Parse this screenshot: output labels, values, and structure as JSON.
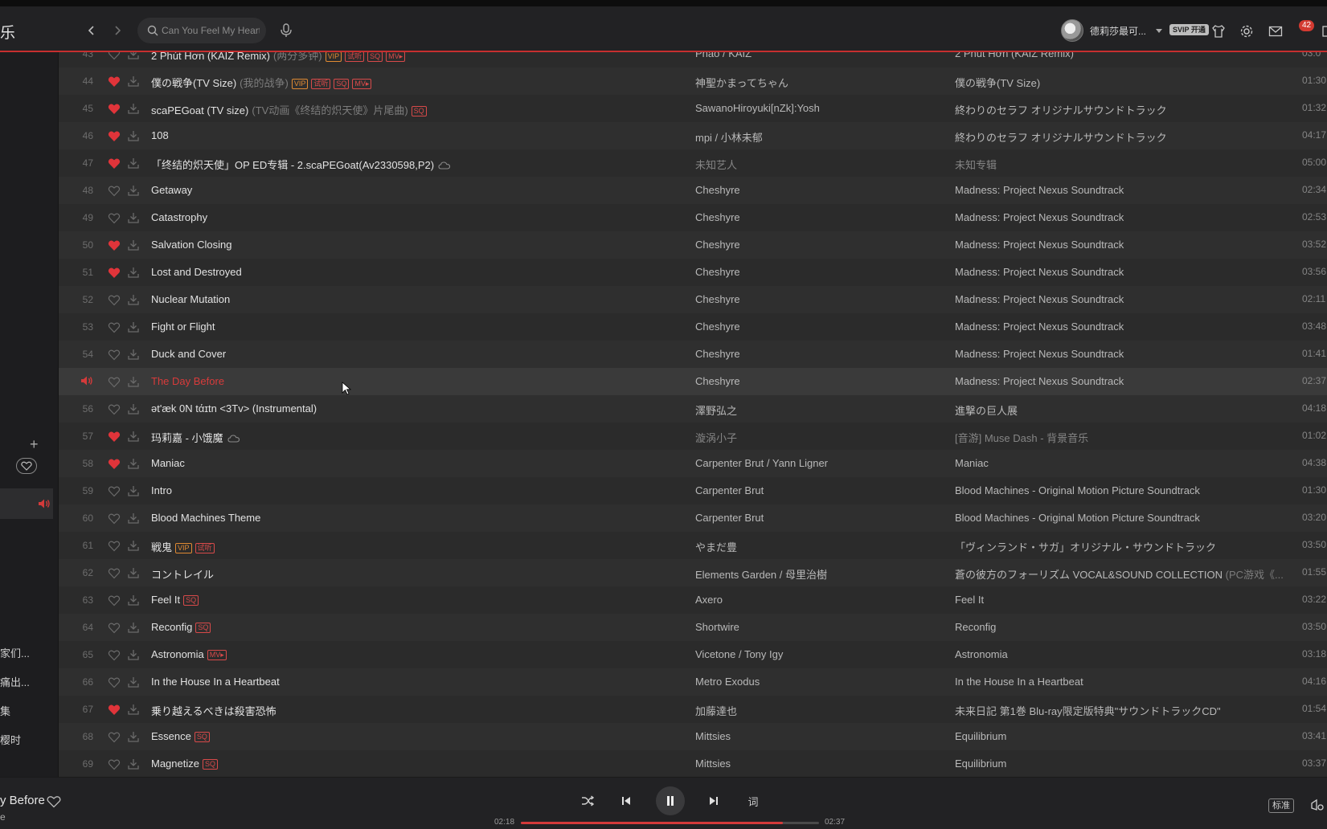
{
  "app": {
    "logo_text": "乐"
  },
  "header": {
    "search_placeholder": "Can You Feel My Heart",
    "username": "德莉莎最可...",
    "vip_label": "SVIP 开通",
    "mail_count": "42"
  },
  "sidebar": {
    "items": [
      "家们...",
      "痛出...",
      "集",
      "樱时"
    ]
  },
  "songs": [
    {
      "num": "43",
      "liked": false,
      "title": "2 Phút Hơn (KAIZ Remix)",
      "alias": "(两分多钟)",
      "tags": [
        "vip",
        "trial",
        "sq",
        "mv"
      ],
      "cloud": false,
      "artist": "Phao / KAIZ",
      "artist_dim": false,
      "album": "2 Phút Hơn (KAIZ Remix)",
      "album_alias": "",
      "album_dim": false,
      "duration": "03:0"
    },
    {
      "num": "44",
      "liked": true,
      "title": "僕の戦争(TV Size)",
      "alias": "(我的战争)",
      "tags": [
        "vip",
        "trial",
        "sq",
        "mv"
      ],
      "cloud": false,
      "artist": "神聖かまってちゃん",
      "artist_dim": false,
      "album": "僕の戦争(TV Size)",
      "album_alias": "",
      "album_dim": false,
      "duration": "01:30"
    },
    {
      "num": "45",
      "liked": true,
      "title": "scaPEGoat (TV size)",
      "alias": "(TV动画《终结的炽天使》片尾曲)",
      "tags": [
        "sq"
      ],
      "cloud": false,
      "artist": "SawanoHiroyuki[nZk]:Yosh",
      "artist_dim": false,
      "album": "終わりのセラフ オリジナルサウンドトラック",
      "album_alias": "",
      "album_dim": false,
      "duration": "01:32"
    },
    {
      "num": "46",
      "liked": true,
      "title": "108",
      "alias": "",
      "tags": [],
      "cloud": false,
      "artist": "mpi / 小林未郁",
      "artist_dim": false,
      "album": "終わりのセラフ オリジナルサウンドトラック",
      "album_alias": "",
      "album_dim": false,
      "duration": "04:17"
    },
    {
      "num": "47",
      "liked": true,
      "title": "「终结的炽天使」OP ED专辑 - 2.scaPEGoat(Av2330598,P2)",
      "alias": "",
      "tags": [],
      "cloud": true,
      "artist": "未知艺人",
      "artist_dim": true,
      "album": "未知专辑",
      "album_alias": "",
      "album_dim": true,
      "duration": "05:00"
    },
    {
      "num": "48",
      "liked": false,
      "title": "Getaway",
      "alias": "",
      "tags": [],
      "cloud": false,
      "artist": "Cheshyre",
      "artist_dim": false,
      "album": "Madness: Project Nexus Soundtrack",
      "album_alias": "",
      "album_dim": false,
      "duration": "02:34"
    },
    {
      "num": "49",
      "liked": false,
      "title": "Catastrophy",
      "alias": "",
      "tags": [],
      "cloud": false,
      "artist": "Cheshyre",
      "artist_dim": false,
      "album": "Madness: Project Nexus Soundtrack",
      "album_alias": "",
      "album_dim": false,
      "duration": "02:53"
    },
    {
      "num": "50",
      "liked": true,
      "title": "Salvation Closing",
      "alias": "",
      "tags": [],
      "cloud": false,
      "artist": "Cheshyre",
      "artist_dim": false,
      "album": "Madness: Project Nexus Soundtrack",
      "album_alias": "",
      "album_dim": false,
      "duration": "03:52"
    },
    {
      "num": "51",
      "liked": true,
      "title": "Lost and Destroyed",
      "alias": "",
      "tags": [],
      "cloud": false,
      "artist": "Cheshyre",
      "artist_dim": false,
      "album": "Madness: Project Nexus Soundtrack",
      "album_alias": "",
      "album_dim": false,
      "duration": "03:56"
    },
    {
      "num": "52",
      "liked": false,
      "title": "Nuclear Mutation",
      "alias": "",
      "tags": [],
      "cloud": false,
      "artist": "Cheshyre",
      "artist_dim": false,
      "album": "Madness: Project Nexus Soundtrack",
      "album_alias": "",
      "album_dim": false,
      "duration": "02:11"
    },
    {
      "num": "53",
      "liked": false,
      "title": "Fight or Flight",
      "alias": "",
      "tags": [],
      "cloud": false,
      "artist": "Cheshyre",
      "artist_dim": false,
      "album": "Madness: Project Nexus Soundtrack",
      "album_alias": "",
      "album_dim": false,
      "duration": "03:48"
    },
    {
      "num": "54",
      "liked": false,
      "title": "Duck and Cover",
      "alias": "",
      "tags": [],
      "cloud": false,
      "artist": "Cheshyre",
      "artist_dim": false,
      "album": "Madness: Project Nexus Soundtrack",
      "album_alias": "",
      "album_dim": false,
      "duration": "01:41"
    },
    {
      "num": "55",
      "playing": true,
      "liked": false,
      "title": "The Day Before",
      "alias": "",
      "tags": [],
      "cloud": false,
      "artist": "Cheshyre",
      "artist_dim": false,
      "album": "Madness: Project Nexus Soundtrack",
      "album_alias": "",
      "album_dim": false,
      "duration": "02:37"
    },
    {
      "num": "56",
      "liked": false,
      "title": "ət'æk 0N tάɪtn <3Tv> (Instrumental)",
      "alias": "",
      "tags": [],
      "cloud": false,
      "artist": "澤野弘之",
      "artist_dim": false,
      "album": "進撃の巨人展",
      "album_alias": "",
      "album_dim": false,
      "duration": "04:18"
    },
    {
      "num": "57",
      "liked": true,
      "title": "玛莉嘉 - 小饿魔",
      "alias": "",
      "tags": [],
      "cloud": true,
      "artist": "漩涡小子",
      "artist_dim": true,
      "album": "[音游] Muse Dash - 背景音乐",
      "album_alias": "",
      "album_dim": true,
      "duration": "01:02"
    },
    {
      "num": "58",
      "liked": true,
      "title": "Maniac",
      "alias": "",
      "tags": [],
      "cloud": false,
      "artist": "Carpenter Brut / Yann Ligner",
      "artist_dim": false,
      "album": "Maniac",
      "album_alias": "",
      "album_dim": false,
      "duration": "04:38"
    },
    {
      "num": "59",
      "liked": false,
      "title": "Intro",
      "alias": "",
      "tags": [],
      "cloud": false,
      "artist": "Carpenter Brut",
      "artist_dim": false,
      "album": "Blood Machines - Original Motion Picture Soundtrack",
      "album_alias": "",
      "album_dim": false,
      "duration": "01:30"
    },
    {
      "num": "60",
      "liked": false,
      "title": "Blood Machines Theme",
      "alias": "",
      "tags": [],
      "cloud": false,
      "artist": "Carpenter Brut",
      "artist_dim": false,
      "album": "Blood Machines - Original Motion Picture Soundtrack",
      "album_alias": "",
      "album_dim": false,
      "duration": "03:20"
    },
    {
      "num": "61",
      "liked": false,
      "title": "戦鬼",
      "alias": "",
      "tags": [
        "vip",
        "trial"
      ],
      "cloud": false,
      "artist": "やまだ豊",
      "artist_dim": false,
      "album": "「ヴィンランド・サガ」オリジナル・サウンドトラック",
      "album_alias": "",
      "album_dim": false,
      "duration": "03:50"
    },
    {
      "num": "62",
      "liked": false,
      "title": "コントレイル",
      "alias": "",
      "tags": [],
      "cloud": false,
      "artist": "Elements Garden / 母里治樹",
      "artist_dim": false,
      "album": "蒼の彼方のフォーリズム VOCAL&SOUND COLLECTION",
      "album_alias": " (PC游戏《...",
      "album_dim": false,
      "duration": "01:55"
    },
    {
      "num": "63",
      "liked": false,
      "title": "Feel It",
      "alias": "",
      "tags": [
        "sq"
      ],
      "cloud": false,
      "artist": "Axero",
      "artist_dim": false,
      "album": "Feel It",
      "album_alias": "",
      "album_dim": false,
      "duration": "03:22"
    },
    {
      "num": "64",
      "liked": false,
      "title": "Reconfig",
      "alias": "",
      "tags": [
        "sq"
      ],
      "cloud": false,
      "artist": "Shortwire",
      "artist_dim": false,
      "album": "Reconfig",
      "album_alias": "",
      "album_dim": false,
      "duration": "03:50"
    },
    {
      "num": "65",
      "liked": false,
      "title": "Astronomia",
      "alias": "",
      "tags": [
        "mv"
      ],
      "cloud": false,
      "artist": "Vicetone / Tony Igy",
      "artist_dim": false,
      "album": "Astronomia",
      "album_alias": "",
      "album_dim": false,
      "duration": "03:18"
    },
    {
      "num": "66",
      "liked": false,
      "title": "In the House In a Heartbeat",
      "alias": "",
      "tags": [],
      "cloud": false,
      "artist": "Metro Exodus",
      "artist_dim": false,
      "album": "In the House In a Heartbeat",
      "album_alias": "",
      "album_dim": false,
      "duration": "04:16"
    },
    {
      "num": "67",
      "liked": true,
      "title": "乗り越えるべきは殺害恐怖",
      "alias": "",
      "tags": [],
      "cloud": false,
      "artist": "加藤達也",
      "artist_dim": false,
      "album": "未来日記 第1巻 Blu-ray限定版特典\"サウンドトラックCD\"",
      "album_alias": "",
      "album_dim": false,
      "duration": "01:54"
    },
    {
      "num": "68",
      "liked": false,
      "title": "Essence",
      "alias": "",
      "tags": [
        "sq"
      ],
      "cloud": false,
      "artist": "Mittsies",
      "artist_dim": false,
      "album": "Equilibrium",
      "album_alias": "",
      "album_dim": false,
      "duration": "03:41"
    },
    {
      "num": "69",
      "liked": false,
      "title": "Magnetize",
      "alias": "",
      "tags": [
        "sq"
      ],
      "cloud": false,
      "artist": "Mittsies",
      "artist_dim": false,
      "album": "Equilibrium",
      "album_alias": "",
      "album_dim": false,
      "duration": "03:37"
    }
  ],
  "tag_labels": {
    "vip": "VIP",
    "trial": "试听",
    "sq": "SQ",
    "mv": "MV▸"
  },
  "player": {
    "now_title": "y Before",
    "now_sub": "e",
    "current_time": "02:18",
    "total_time": "02:37",
    "progress": 0.88,
    "lyrics_label": "词",
    "quality_label": "标准"
  },
  "colors": {
    "accent": "#d33a3a",
    "liked_heart": "#e0343a",
    "vip_tag": "#e08a33"
  }
}
